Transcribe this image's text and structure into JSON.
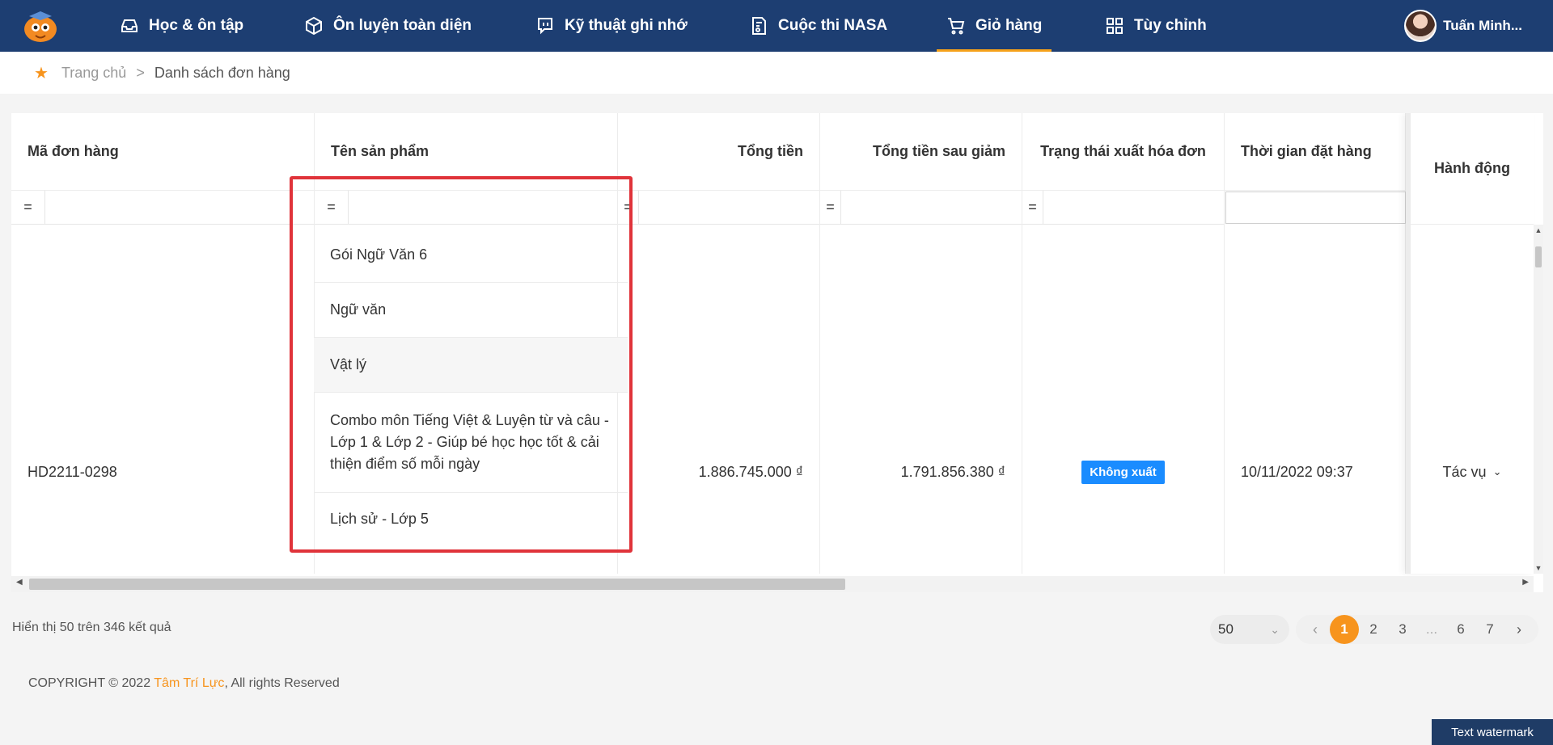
{
  "nav": {
    "items": [
      {
        "label": "Học & ôn tập",
        "icon": "inbox-icon"
      },
      {
        "label": "Ôn luyện toàn diện",
        "icon": "box-icon"
      },
      {
        "label": "Kỹ thuật ghi nhớ",
        "icon": "chat-icon"
      },
      {
        "label": "Cuộc thi NASA",
        "icon": "certificate-icon"
      },
      {
        "label": "Giỏ hàng",
        "icon": "cart-icon",
        "active": true
      },
      {
        "label": "Tùy chỉnh",
        "icon": "grid-icon"
      }
    ],
    "user_name": "Tuấn Minh..."
  },
  "breadcrumb": {
    "home": "Trang chủ",
    "separator": ">",
    "current": "Danh sách đơn hàng"
  },
  "table": {
    "headers": {
      "order_id": "Mã đơn hàng",
      "product": "Tên sản phẩm",
      "total": "Tổng tiền",
      "total_after_discount": "Tổng tiền sau giảm",
      "invoice_status": "Trạng thái xuất hóa đơn",
      "order_time": "Thời gian đặt hàng",
      "action": "Hành động"
    },
    "filter_operator": "=",
    "row": {
      "order_id": "HD2211-0298",
      "total": "1.886.745.000 ₫",
      "total_after_discount": "1.791.856.380 ₫",
      "invoice_status": "Không xuất",
      "order_time": "10/11/2022 09:37",
      "action": "Tác vụ"
    },
    "product_list": [
      "Gói Ngữ Văn 6",
      "Ngữ văn",
      "Vật lý",
      "Combo môn Tiếng Việt & Luyện từ và câu - Lớp 1 & Lớp 2 - Giúp bé học học tốt & cải thiện điểm số mỗi ngày",
      "Lịch sử - Lớp 5"
    ]
  },
  "results_text": "Hiển thị 50 trên 346 kết quả",
  "pagination": {
    "page_size": "50",
    "pages": [
      "1",
      "2",
      "3",
      "...",
      "6",
      "7"
    ],
    "current": "1"
  },
  "footer": {
    "copyright_prefix": "COPYRIGHT © 2022 ",
    "brand": "Tâm Trí Lực",
    "suffix": ", All rights Reserved"
  },
  "watermark": "Text watermark",
  "colors": {
    "nav_bg": "#1d3e72",
    "accent": "#f7941d",
    "badge": "#1a8cff",
    "highlight_border": "#e0333a"
  }
}
